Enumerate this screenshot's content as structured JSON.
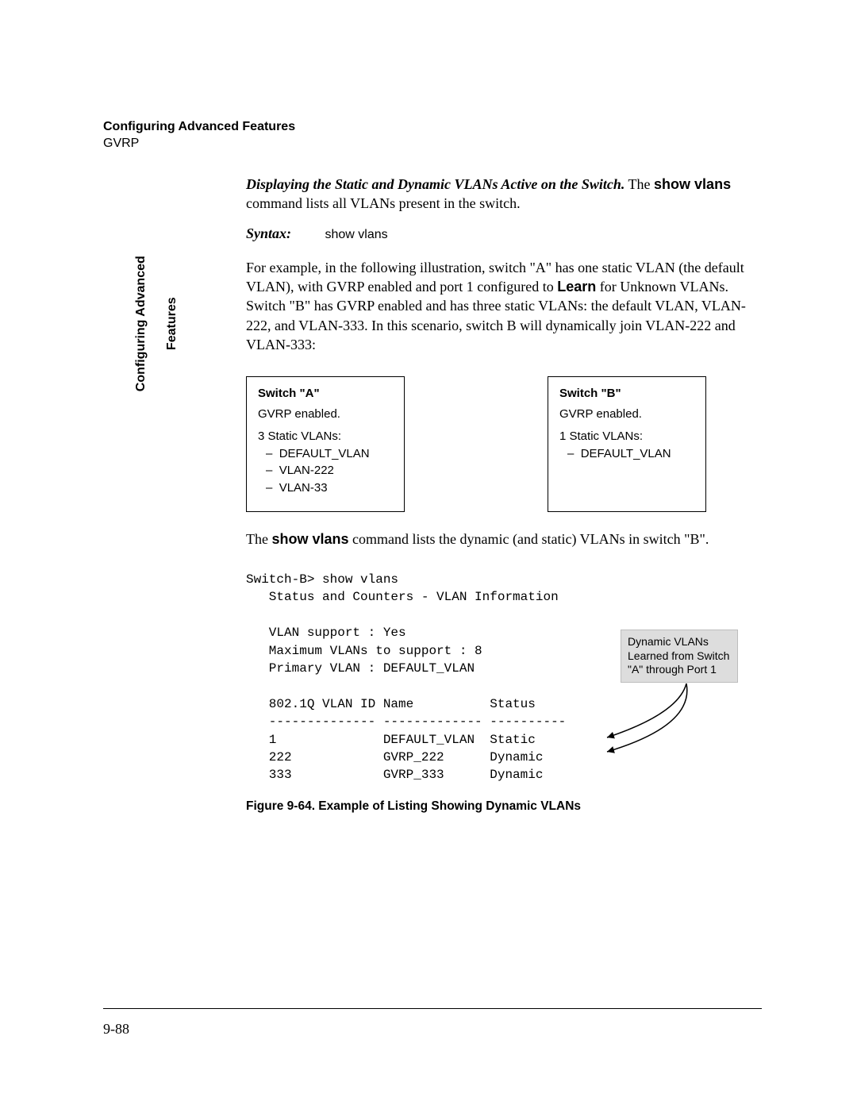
{
  "header": {
    "title": "Configuring Advanced Features",
    "subtitle": "GVRP"
  },
  "side_tab": {
    "line1": "Configuring Advanced",
    "line2": "Features"
  },
  "body": {
    "p1_bold": "Displaying the Static and Dynamic VLANs Active on the Switch.",
    "p1_rest": " The ",
    "p1_show": "show vlans",
    "p1_tail": " command lists all VLANs present in the switch.",
    "syntax_label": "Syntax:",
    "syntax_cmd": "show vlans",
    "p2a": "For example, in the following illustration, switch \"A\" has one static VLAN (the default VLAN), with GVRP enabled and port 1 configured to ",
    "p2_learn": "Learn",
    "p2b": " for Unknown VLANs. Switch \"B\" has GVRP enabled and has three static VLANs: the default VLAN, VLAN-222, and VLAN-333. In this scenario, switch B will dynamically join VLAN-222 and VLAN-333:",
    "p3a": "The ",
    "p3_show": "show vlans",
    "p3b": " command lists the dynamic (and static) VLANs in switch \"B\"."
  },
  "switch_a": {
    "title": "Switch \"A\"",
    "enabled": "GVRP enabled.",
    "header": "3 Static VLANs:",
    "v1": "DEFAULT_VLAN",
    "v2": "VLAN-222",
    "v3": "VLAN-33"
  },
  "switch_b": {
    "title": "Switch \"B\"",
    "enabled": "GVRP enabled.",
    "header": "1 Static VLANs:",
    "v1": "DEFAULT_VLAN"
  },
  "cli": {
    "l1": "Switch-B> show vlans",
    "l2": "   Status and Counters - VLAN Information",
    "l3": "",
    "l4": "   VLAN support : Yes",
    "l5": "   Maximum VLANs to support : 8",
    "l6": "   Primary VLAN : DEFAULT_VLAN",
    "l7": "",
    "l8": "   802.1Q VLAN ID Name          Status",
    "l9": "   -------------- ------------- ----------",
    "l10": "   1              DEFAULT_VLAN  Static",
    "l11": "   222            GVRP_222      Dynamic",
    "l12": "   333            GVRP_333      Dynamic"
  },
  "callout": {
    "text": "Dynamic VLANs Learned from Switch \"A\" through Port 1"
  },
  "figure_caption": "Figure 9-64.  Example of Listing Showing Dynamic VLANs",
  "page_number": "9-88"
}
